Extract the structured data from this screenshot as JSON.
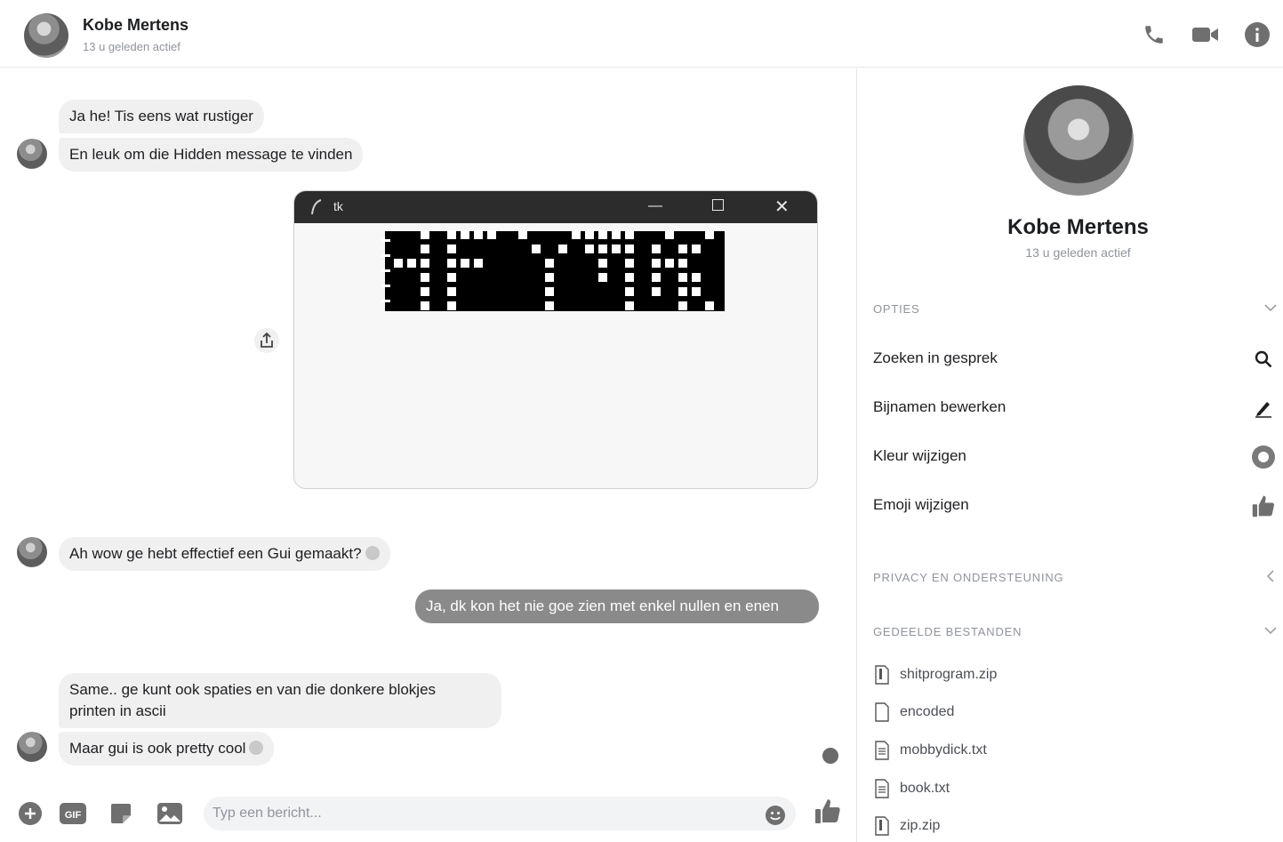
{
  "header": {
    "name": "Kobe Mertens",
    "status": "13 u geleden actief",
    "icons": [
      "phone-icon",
      "video-icon",
      "info-icon"
    ]
  },
  "messages": [
    {
      "text": "Ja he! Tis eens wat rustiger",
      "direction": "incoming"
    },
    {
      "text": "En leuk om die Hidden message te vinden",
      "direction": "incoming"
    },
    {
      "text": "Ah wow ge hebt effectief een Gui gemaakt?",
      "direction": "incoming"
    },
    {
      "text": "Ja, dk kon het nie goe zien met enkel nullen en enen",
      "direction": "outgoing"
    },
    {
      "text_line1": "Same.. ge kunt ook spaties en van die donkere blokjes",
      "text_line2": "printen in ascii",
      "direction": "incoming"
    },
    {
      "text": "Maar gui is ook pretty cool",
      "direction": "incoming"
    }
  ],
  "tk_window": {
    "title": "tk",
    "minimize": "—",
    "close": "✕"
  },
  "composer": {
    "placeholder": "Typ een bericht...",
    "gif_label": "GIF",
    "icons": [
      "add-icon",
      "gif-icon",
      "sticker-icon",
      "image-icon",
      "emoji-icon",
      "like-icon"
    ]
  },
  "panel": {
    "name": "Kobe Mertens",
    "status": "13 u geleden actief",
    "options_header": "Opties",
    "options": [
      {
        "label": "Zoeken in gesprek",
        "icon": "search-icon"
      },
      {
        "label": "Bijnamen bewerken",
        "icon": "pencil-icon"
      },
      {
        "label": "Kleur wijzigen",
        "icon": "color-icon"
      },
      {
        "label": "Emoji wijzigen",
        "icon": "thumbs-up-icon"
      }
    ],
    "privacy_header": "Privacy en ondersteuning",
    "files_header": "Gedeelde bestanden",
    "files": [
      "shitprogram.zip",
      "encoded",
      "mobbydick.txt",
      "book.txt",
      "zip.zip"
    ]
  },
  "colors": {
    "incoming_bubble": "#f1f0f0",
    "outgoing_bubble": "#8a8a8a",
    "muted_text": "#90949c"
  }
}
